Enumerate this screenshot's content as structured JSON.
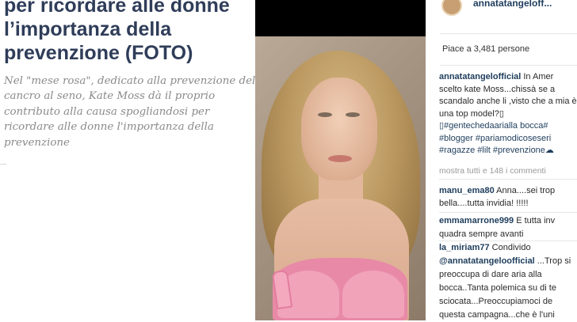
{
  "article": {
    "title": "per ricordare alle donne l’importanza della prevenzione (FOTO)",
    "excerpt": "Nel \"mese rosa\", dedicato alla prevenzione del cancro al seno, Kate Moss dà il proprio contributo alla causa spogliandosi per ricordare alle donne l'importanza della prevenzione"
  },
  "instagram": {
    "username": "annatatangeloff...",
    "likes": "Piace a 3,481 persone",
    "caption": {
      "author": "annatatangelofficial",
      "text_before": " In Amer scelto kate Moss...chissà se a scandalo anche li ,visto che a mia è una top model?▯ ",
      "hashtags": [
        "▯#gentechedaarialla bocca#",
        "#blogger #pariamodicoseseri",
        "#ragazze #lilt #prevenzione"
      ]
    },
    "more_comments": "mostra tutti e 148 i commenti",
    "comments": [
      {
        "author": "manu_ema80",
        "text": " Anna....sei trop bella....tutta invidia! !!!!!"
      },
      {
        "author": "emmamarrone999",
        "text": " E tutta inv quadra sempre avanti"
      },
      {
        "author": "la_miriam77",
        "text": " Condivido",
        "mention": "@annatatangeloofficial",
        "text2": " ...Trop si preoccupa di dare aria alla bocca..Tanta polemica su di te sciocata...Preoccupiamoci de questa campagna...che è l'uni"
      }
    ],
    "colors": {
      "link": "#1e3d5c",
      "muted": "#999999"
    }
  },
  "photo": {
    "subject": "woman-portrait"
  },
  "article_colors": {
    "title": "#2f3d59",
    "excerpt": "#8a8a8a"
  }
}
